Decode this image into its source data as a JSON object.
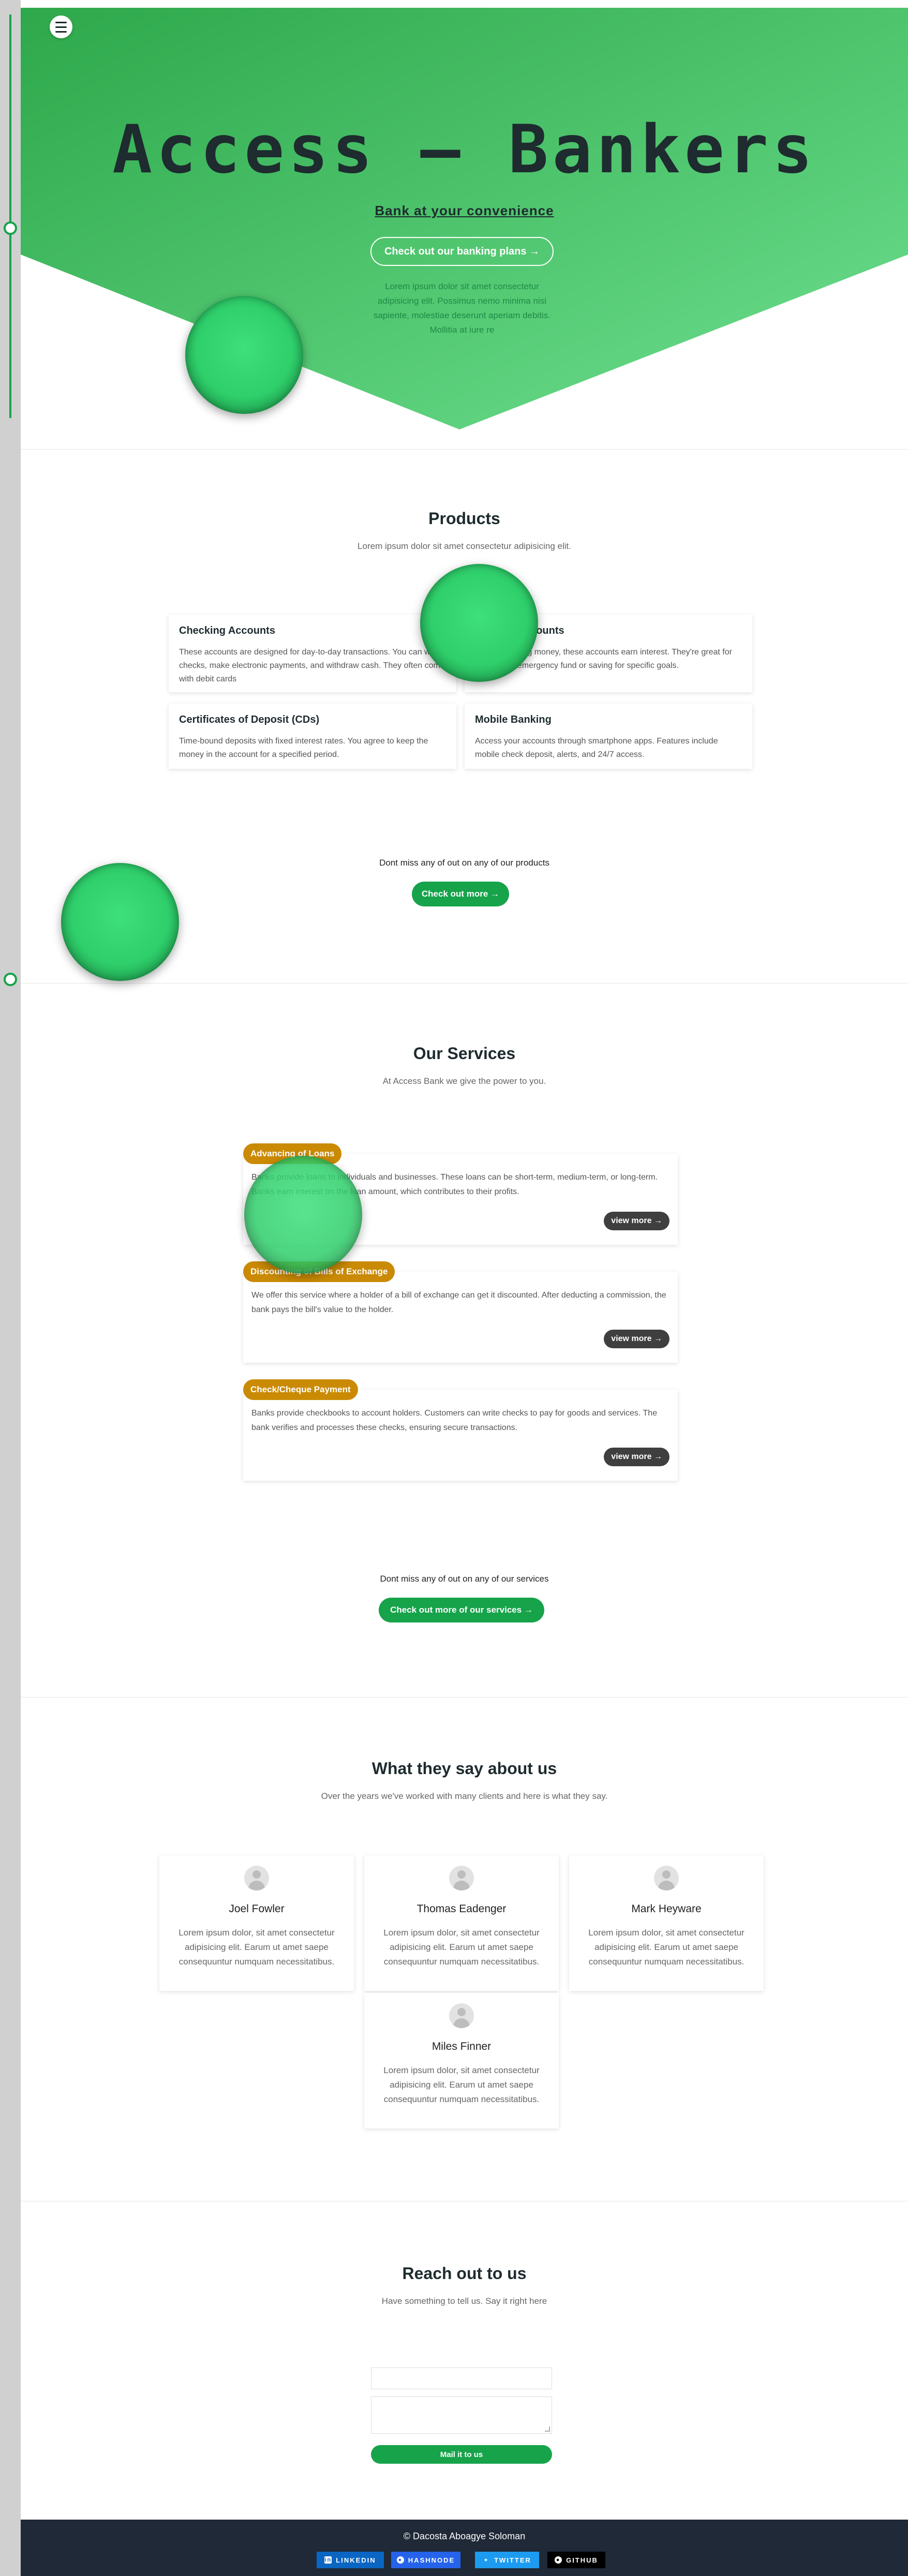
{
  "colors": {
    "brand_green": "#16a34a",
    "hero_gradient_start": "#2ea84b",
    "hero_gradient_end": "#6ee08f",
    "badge_gold": "#ca8a04",
    "dark": "#1e2b2f",
    "footer_bg": "#1f2937"
  },
  "nav": {
    "menu_icon": "hamburger-icon"
  },
  "hero": {
    "title": "Access – Bankers",
    "subtitle": "Bank at your convenience",
    "button": "Check out our banking plans →",
    "lorem": "Lorem ipsum dolor sit amet consectetur adipisicing elit. Possimus nemo minima nisi sapiente, molestiae deserunt aperiam debitis. Mollitia at iure re"
  },
  "products": {
    "title": "Products",
    "subtitle": "Lorem ipsum dolor sit amet consectetur adipisicing elit.",
    "items": [
      {
        "title": "Checking Accounts",
        "text": "These accounts are designed for day-to-day transactions. You can write checks, make electronic payments, and withdraw cash. They often come with debit cards"
      },
      {
        "title": "Savings Accounts",
        "text": "Ideal for storing money, these accounts earn interest. They're great for building an emergency fund or saving for specific goals."
      },
      {
        "title": "Certificates of Deposit (CDs)",
        "text": "Time-bound deposits with fixed interest rates. You agree to keep the money in the account for a specified period."
      },
      {
        "title": "Mobile Banking",
        "text": "Access your accounts through smartphone apps. Features include mobile check deposit, alerts, and 24/7 access."
      }
    ],
    "cta_text": "Dont miss any of out on any of our products",
    "cta_button": "Check out more →"
  },
  "services": {
    "title": "Our Services",
    "subtitle": "At Access Bank we give the power to you.",
    "items": [
      {
        "badge": "Advancing of Loans",
        "text": "Banks provide loans to individuals and businesses. These loans can be short-term, medium-term, or long-term. Banks earn interest on the loan amount, which contributes to their profits.",
        "more": "view more →"
      },
      {
        "badge": "Discounting of Bills of Exchange",
        "text": "We offer this service where a holder of a bill of exchange can get it discounted. After deducting a commission, the bank pays the bill's value to the holder.",
        "more": "view more →"
      },
      {
        "badge": "Check/Cheque Payment",
        "text": "Banks provide checkbooks to account holders. Customers can write checks to pay for goods and services. The bank verifies and processes these checks, ensuring secure transactions.",
        "more": "view more →"
      }
    ],
    "cta_text": "Dont miss any of out on any of our services",
    "cta_button": "Check out more of our services →"
  },
  "testimonials": {
    "title": "What they say about us",
    "subtitle": "Over the years we've worked with many clients and here is what they say.",
    "items": [
      {
        "name": "Joel Fowler",
        "quote": "Lorem ipsum dolor, sit amet consectetur adipisicing elit. Earum ut amet saepe consequuntur numquam necessitatibus."
      },
      {
        "name": "Thomas Eadenger",
        "quote": "Lorem ipsum dolor, sit amet consectetur adipisicing elit. Earum ut amet saepe consequuntur numquam necessitatibus."
      },
      {
        "name": "Mark Heyware",
        "quote": "Lorem ipsum dolor, sit amet consectetur adipisicing elit. Earum ut amet saepe consequuntur numquam necessitatibus."
      },
      {
        "name": "Miles Finner",
        "quote": "Lorem ipsum dolor, sit amet consectetur adipisicing elit. Earum ut amet saepe consequuntur numquam necessitatibus."
      }
    ]
  },
  "contact": {
    "title": "Reach out to us",
    "subtitle": "Have something to tell us. Say it right here",
    "submit": "Mail it to us"
  },
  "footer": {
    "copyright": "©  Dacosta Aboagye Soloman",
    "socials": [
      {
        "label": "LINKEDIN",
        "icon": "linkedin-icon",
        "color": "#0a66c2"
      },
      {
        "label": "HASHNODE",
        "icon": "hashnode-icon",
        "color": "#2563eb"
      },
      {
        "label": "TWITTER",
        "icon": "twitter-icon",
        "color": "#1d9bf0"
      },
      {
        "label": "GITHUB",
        "icon": "github-icon",
        "color": "#000000"
      }
    ]
  }
}
